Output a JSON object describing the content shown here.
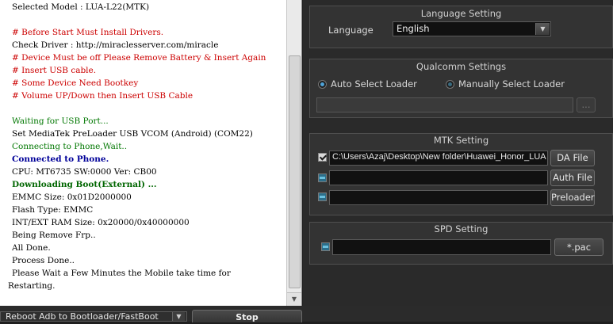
{
  "log": {
    "lines": [
      {
        "text": "Selected Model : LUA-L22(MTK)",
        "color": "#000000",
        "bold": false
      },
      {
        "text": "# Before Start Must Install Drivers.",
        "color": "#cc0000",
        "bold": false
      },
      {
        "text": "Check Driver : http://miraclesserver.com/miracle",
        "color": "#000000",
        "bold": false
      },
      {
        "text": "# Device Must be off Please Remove Battery & Insert Again",
        "color": "#cc0000",
        "bold": false
      },
      {
        "text": "# Insert USB cable.",
        "color": "#cc0000",
        "bold": false
      },
      {
        "text": "# Some Device Need Bootkey",
        "color": "#cc0000",
        "bold": false
      },
      {
        "text": "# Volume UP/Down then Insert USB Cable",
        "color": "#cc0000",
        "bold": false
      },
      {
        "text": "Waiting for USB Port...",
        "color": "#007700",
        "bold": false
      },
      {
        "text": "Set MediaTek PreLoader USB VCOM (Android) (COM22)",
        "color": "#000000",
        "bold": false
      },
      {
        "text": "Connecting to Phone,Wait..",
        "color": "#007700",
        "bold": false
      },
      {
        "text": "Connected to Phone.",
        "color": "#000099",
        "bold": true
      },
      {
        "text": "CPU: MT6735 SW:0000 Ver: CB00",
        "color": "#000000",
        "bold": false
      },
      {
        "text": "Downloading Boot(External) ...",
        "color": "#006600",
        "bold": true
      },
      {
        "text": "EMMC Size: 0x01D2000000",
        "color": "#000000",
        "bold": false
      },
      {
        "text": "Flash Type: EMMC",
        "color": "#000000",
        "bold": false
      },
      {
        "text": "INT/EXT RAM  Size: 0x20000/0x40000000",
        "color": "#000000",
        "bold": false
      },
      {
        "text": "Being Remove Frp..",
        "color": "#000000",
        "bold": false
      },
      {
        "text": "All Done.",
        "color": "#000000",
        "bold": false
      },
      {
        "text": "Process Done..",
        "color": "#000000",
        "bold": false
      },
      {
        "text": "Please Wait a Few Minutes the Mobile take time for",
        "color": "#000000",
        "bold": false
      },
      {
        "text": "Restarting.",
        "color": "#000000",
        "bold": false
      }
    ]
  },
  "bottom": {
    "boot_option": "Reboot Adb to Bootloader/FastBoot",
    "stop_label": "Stop"
  },
  "language": {
    "title": "Language Setting",
    "label": "Language",
    "value": "English"
  },
  "qualcomm": {
    "title": "Qualcomm Settings",
    "auto_label": "Auto Select Loader",
    "manual_label": "Manually Select Loader",
    "browse_label": "..."
  },
  "mtk": {
    "title": "MTK Setting",
    "da_path": "C:\\Users\\Azaj\\Desktop\\New folder\\Huawei_Honor_LUA",
    "da_label": "DA File",
    "auth_label": "Auth File",
    "preloader_label": "Preloader"
  },
  "spd": {
    "title": "SPD Setting",
    "pac_label": "*.pac"
  }
}
